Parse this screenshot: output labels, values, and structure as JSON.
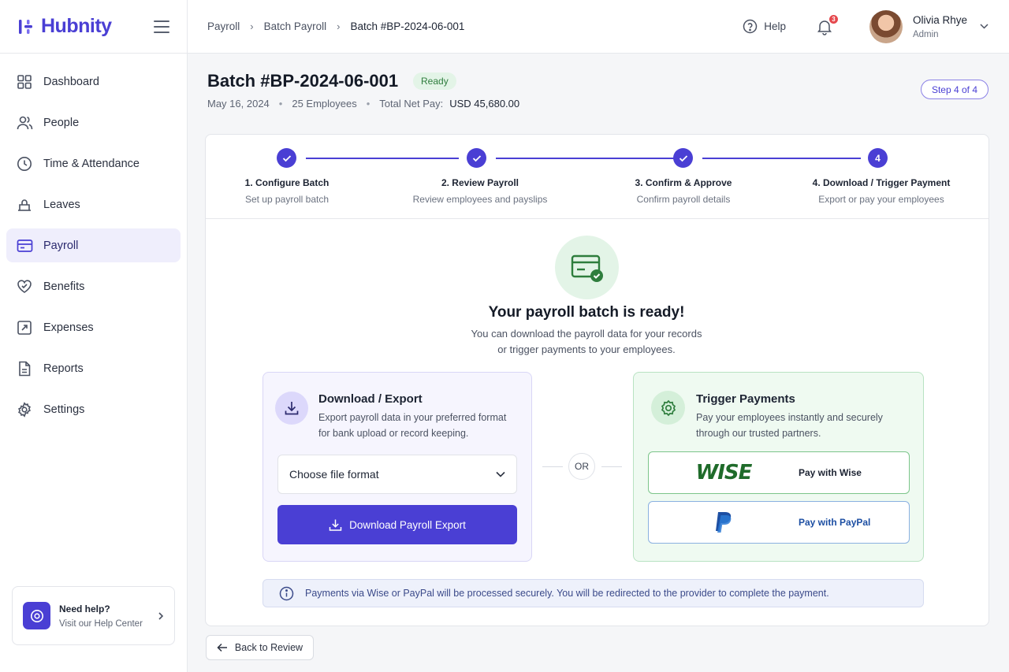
{
  "app": {
    "name": "Hubnity"
  },
  "sidebar": {
    "items": [
      {
        "label": "Dashboard",
        "icon": "dashboard-icon"
      },
      {
        "label": "People",
        "icon": "people-icon"
      },
      {
        "label": "Time & Attendance",
        "icon": "clock-icon"
      },
      {
        "label": "Leaves",
        "icon": "leaves-icon"
      },
      {
        "label": "Payroll",
        "icon": "payroll-icon",
        "active": true
      },
      {
        "label": "Benefits",
        "icon": "heart-icon"
      },
      {
        "label": "Expenses",
        "icon": "expenses-icon"
      },
      {
        "label": "Reports",
        "icon": "report-icon"
      },
      {
        "label": "Settings",
        "icon": "gear-icon"
      }
    ],
    "help": {
      "title": "Need help?",
      "subtitle": "Visit our Help Center"
    }
  },
  "topbar": {
    "breadcrumbs": [
      "Payroll",
      "Batch Payroll",
      "Batch #BP-2024-06-001"
    ],
    "help_label": "Help",
    "notifications": "3",
    "user": {
      "name": "Olivia Rhye",
      "role": "Admin"
    }
  },
  "header": {
    "title": "Batch #BP-2024-06-001",
    "status": "Ready",
    "date": "May 16, 2024",
    "employees": "25 Employees",
    "net_pay_label": "Total Net Pay:",
    "net_pay_value": "USD 45,680.00",
    "step_indicator": "Step 4 of 4"
  },
  "stepper": {
    "steps": [
      {
        "number": "1",
        "title": "1. Configure Batch",
        "desc": "Set up payroll batch",
        "completed": true
      },
      {
        "number": "2",
        "title": "2. Review Payroll",
        "desc": "Review employees and payslips",
        "completed": true
      },
      {
        "number": "3",
        "title": "3. Confirm & Approve",
        "desc": "Confirm payroll details",
        "completed": true
      },
      {
        "number": "4",
        "title": "4. Download / Trigger Payment",
        "desc": "Export or pay your employees",
        "completed": false
      }
    ]
  },
  "ready": {
    "title": "Your payroll batch is ready!",
    "subtitle_line1": "You can download the payroll data for your records",
    "subtitle_line2": "or trigger payments to your employees."
  },
  "export": {
    "title": "Download / Export",
    "desc_line1": "Export payroll data in your preferred format",
    "desc_line2": "for bank upload or record keeping.",
    "select_placeholder": "Choose file format",
    "button_label": "Download Payroll Export"
  },
  "divider_label": "OR",
  "payments": {
    "title": "Trigger Payments",
    "desc_line1": "Pay your employees instantly and securely",
    "desc_line2": "through our trusted partners.",
    "wise_logo": "WISE",
    "wise_label": "Pay with Wise",
    "paypal_label": "Pay with PayPal"
  },
  "info_message": "Payments via Wise or PayPal will be processed securely. You will be redirected to the provider to complete the payment.",
  "footer": {
    "back_label": "Back to Review"
  },
  "colors": {
    "accent": "#4a3fd4",
    "success": "#2e7d3d",
    "paypal": "#1d4fa3"
  }
}
